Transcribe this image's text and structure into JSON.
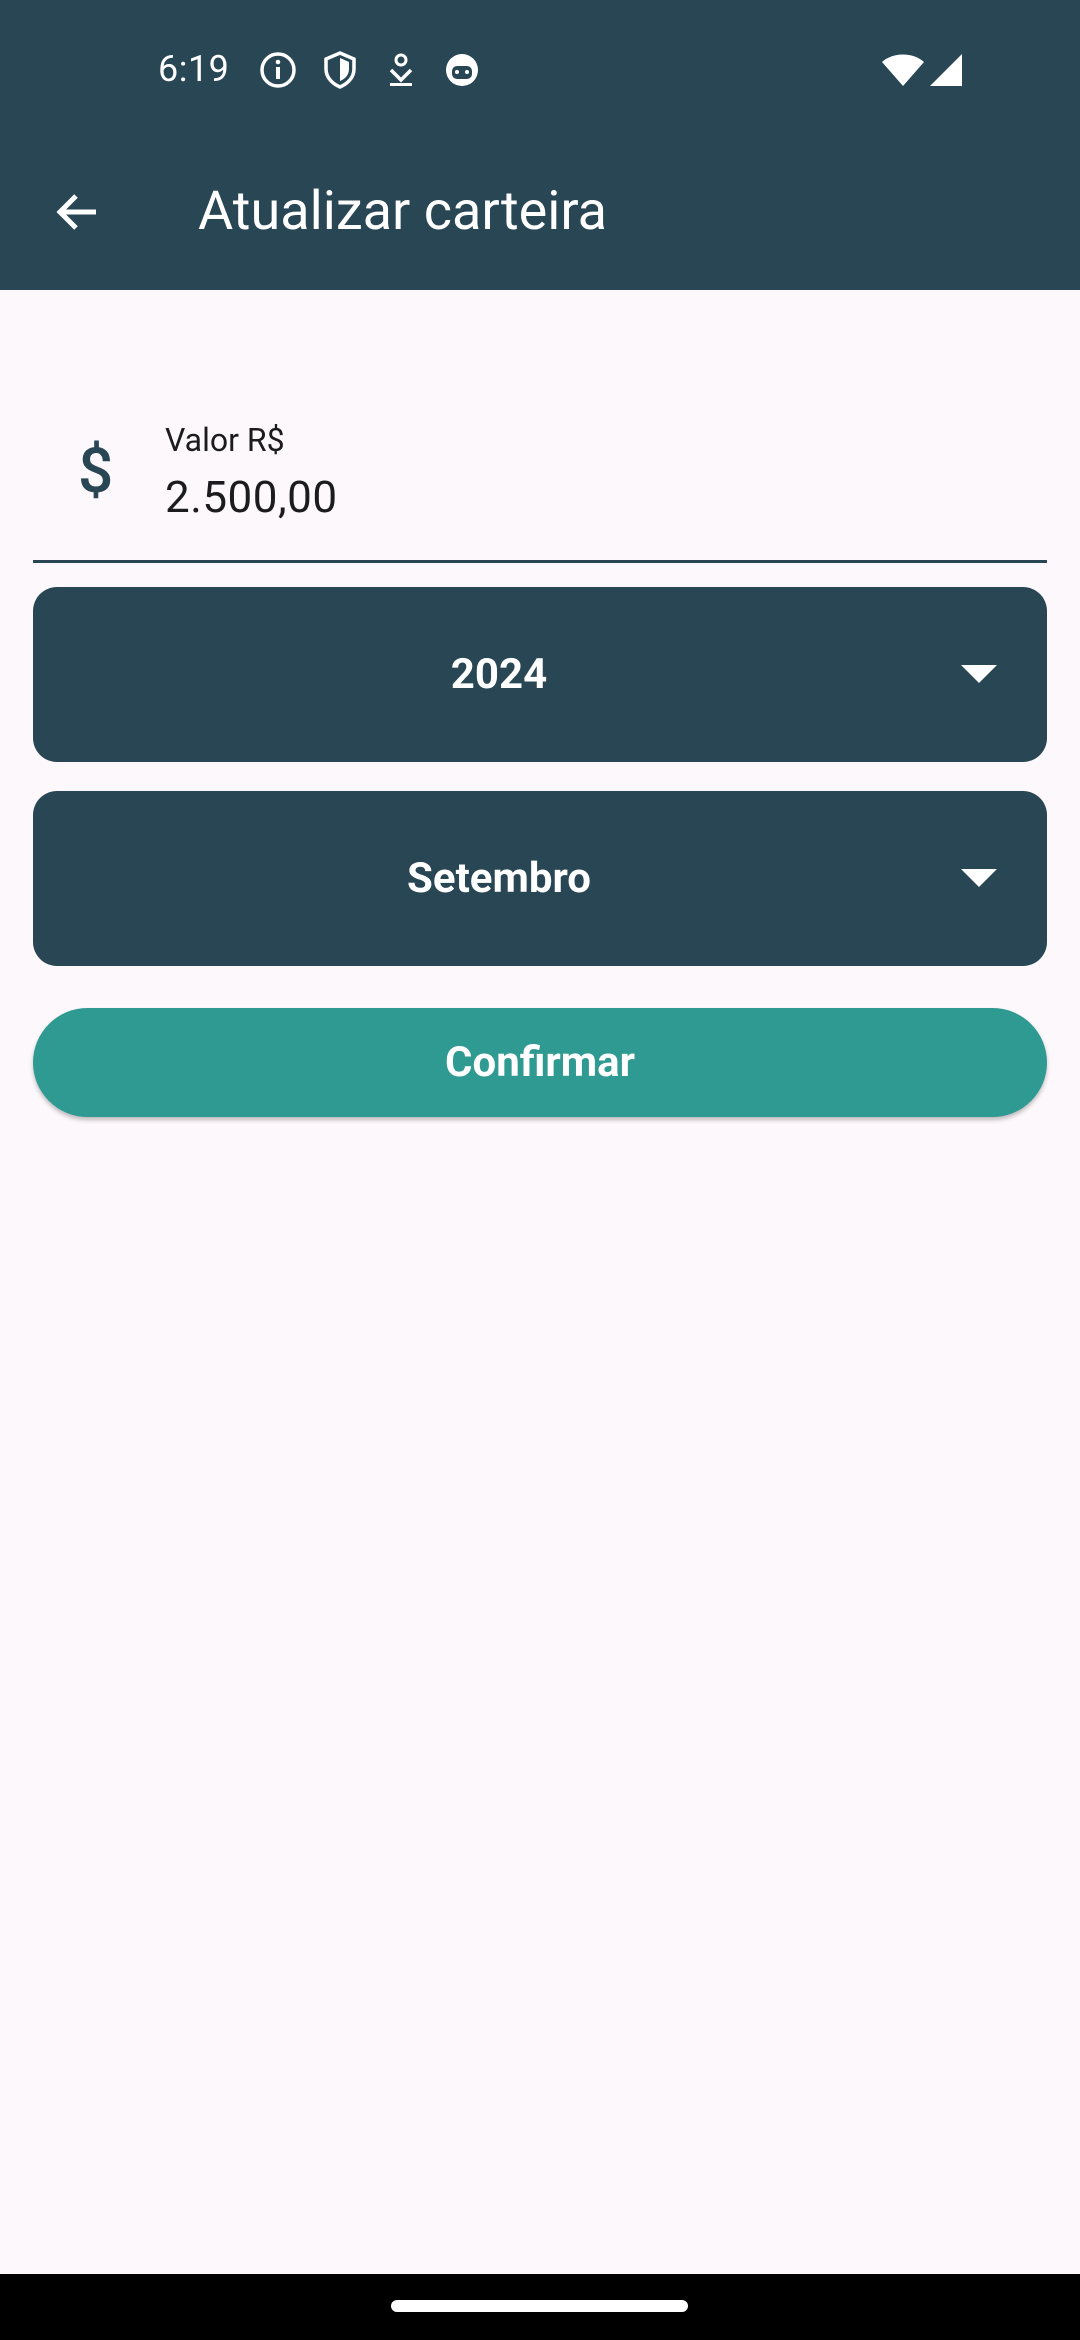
{
  "status_bar": {
    "time": "6:19",
    "icons": [
      "info-icon",
      "shield-icon",
      "download-icon",
      "app-face-icon",
      "wifi-icon",
      "signal-icon"
    ]
  },
  "toolbar": {
    "title": "Atualizar carteira",
    "back_icon": "arrow-back-icon"
  },
  "form": {
    "value_field": {
      "icon": "dollar-icon",
      "icon_glyph": "$",
      "label": "Valor R$",
      "value": "2.500,00"
    },
    "year_dropdown": {
      "selected": "2024"
    },
    "month_dropdown": {
      "selected": "Setembro"
    },
    "confirm_label": "Confirmar"
  },
  "colors": {
    "primary": "#284654",
    "accent": "#2e9a91",
    "background": "#fdf8fc"
  }
}
